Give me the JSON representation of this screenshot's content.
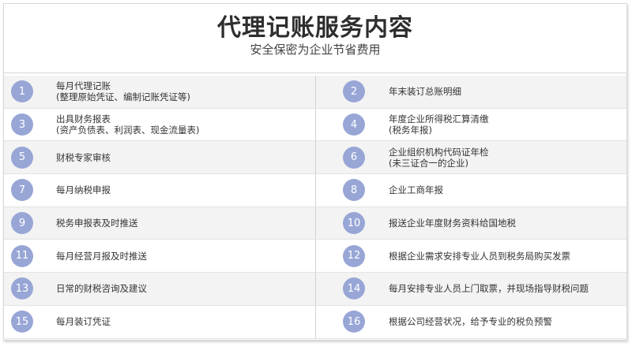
{
  "header": {
    "title": "代理记账服务内容",
    "subtitle": "安全保密为企业节省费用"
  },
  "colors": {
    "badge": "#98a6d6",
    "row_alt": "#f3f3f3"
  },
  "rows": [
    {
      "left": {
        "num": "1",
        "line1": "每月代理记账",
        "line2": "(整理原始凭证、编制记账凭证等)"
      },
      "right": {
        "num": "2",
        "line1": "年末装订总账明细",
        "line2": ""
      }
    },
    {
      "left": {
        "num": "3",
        "line1": "出具财务报表",
        "line2": "(资产负债表、利润表、现金流量表)"
      },
      "right": {
        "num": "4",
        "line1": "年度企业所得税汇算清缴",
        "line2": "(税务年报)"
      }
    },
    {
      "left": {
        "num": "5",
        "line1": "财税专家审核",
        "line2": ""
      },
      "right": {
        "num": "6",
        "line1": "企业组织机构代码证年检",
        "line2": "(未三证合一的企业)"
      }
    },
    {
      "left": {
        "num": "7",
        "line1": "每月纳税申报",
        "line2": ""
      },
      "right": {
        "num": "8",
        "line1": "企业工商年报",
        "line2": ""
      }
    },
    {
      "left": {
        "num": "9",
        "line1": "税务申报表及时推送",
        "line2": ""
      },
      "right": {
        "num": "10",
        "line1": "报送企业年度财务资料给国地税",
        "line2": ""
      }
    },
    {
      "left": {
        "num": "11",
        "line1": "每月经营月报及时推送",
        "line2": ""
      },
      "right": {
        "num": "12",
        "line1": "根据企业需求安排专业人员到税务局购买发票",
        "line2": ""
      }
    },
    {
      "left": {
        "num": "13",
        "line1": "日常的财税咨询及建议",
        "line2": ""
      },
      "right": {
        "num": "14",
        "line1": "每月安排专业人员上门取票，并现场指导财税问题",
        "line2": ""
      }
    },
    {
      "left": {
        "num": "15",
        "line1": "每月装订凭证",
        "line2": ""
      },
      "right": {
        "num": "16",
        "line1": "根据公司经营状况，给予专业的税负预警",
        "line2": ""
      }
    }
  ]
}
